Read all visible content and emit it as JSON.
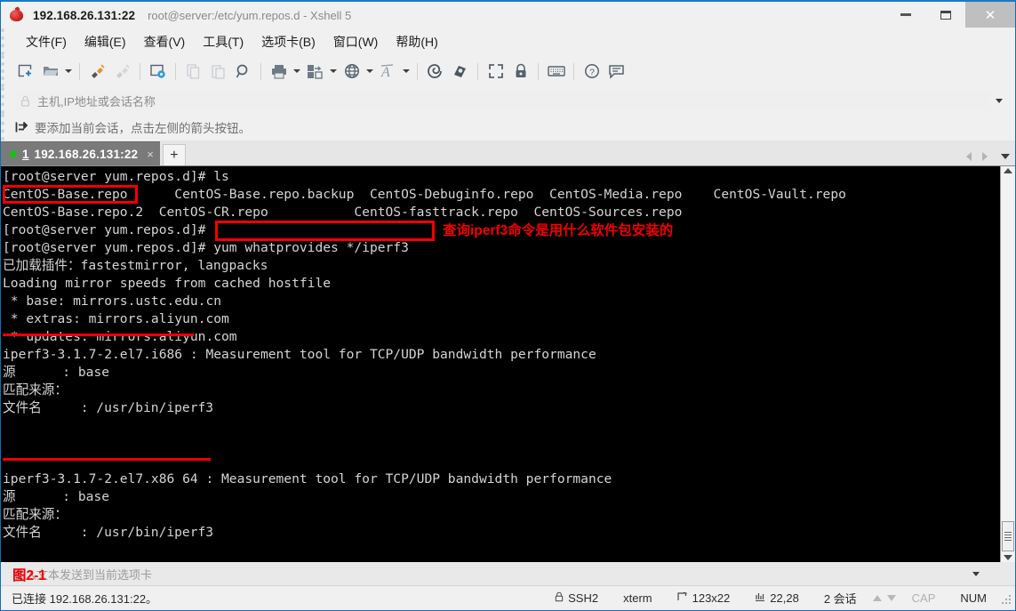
{
  "window": {
    "ip_title": "192.168.26.131:22",
    "path_title": "root@server:/etc/yum.repos.d - Xshell 5",
    "app_icon": "xshell-icon",
    "minimize": "−",
    "maximize": "□",
    "close": "✕"
  },
  "menu": {
    "items": [
      {
        "label": "文件(F)",
        "name": "menu-file"
      },
      {
        "label": "编辑(E)",
        "name": "menu-edit"
      },
      {
        "label": "查看(V)",
        "name": "menu-view"
      },
      {
        "label": "工具(T)",
        "name": "menu-tools"
      },
      {
        "label": "选项卡(B)",
        "name": "menu-tabs"
      },
      {
        "label": "窗口(W)",
        "name": "menu-window"
      },
      {
        "label": "帮助(H)",
        "name": "menu-help"
      }
    ]
  },
  "toolbar": {
    "icons": [
      "new-session-icon",
      "open-folder-icon",
      "connect-plug-icon",
      "disconnect-plug-icon",
      "session-properties-icon",
      "copy-icon",
      "paste-icon",
      "find-icon",
      "print-icon",
      "file-transfer-icon",
      "globe-icon",
      "font-icon",
      "shell-icon",
      "tunnel-icon",
      "fullscreen-icon",
      "lock-icon",
      "keyboard-icon",
      "help-icon",
      "chat-icon"
    ]
  },
  "quick_connect": {
    "lock_icon": "lock-icon",
    "placeholder": "主机,IP地址或会话名称",
    "dropdown_icon": "chevron-down-icon"
  },
  "hint": {
    "icon": "arrow-into-box-icon",
    "text": "要添加当前会话，点击左侧的箭头按钮。"
  },
  "tabs": {
    "active": {
      "status_dot_color": "#18c018",
      "number": "1",
      "label": "192.168.26.131:22",
      "close_label": "×"
    },
    "new_tab_label": "+",
    "nav_prev_icon": "chevron-left-icon",
    "nav_next_icon": "chevron-right-icon",
    "nav_list_icon": "chevron-down-icon"
  },
  "terminal": {
    "background": "#000000",
    "foreground": "#d4d4d4",
    "lines": [
      "[root@server yum.repos.d]# ls",
      "CentOS-Base.repo      CentOS-Base.repo.backup  CentOS-Debuginfo.repo  CentOS-Media.repo    CentOS-Vault.repo",
      "CentOS-Base.repo.2  CentOS-CR.repo           CentOS-fasttrack.repo  CentOS-Sources.repo",
      "[root@server yum.repos.d]#",
      "[root@server yum.repos.d]# yum whatprovides */iperf3",
      "已加载插件：fastestmirror, langpacks",
      "Loading mirror speeds from cached hostfile",
      " * base: mirrors.ustc.edu.cn",
      " * extras: mirrors.aliyun.com",
      " * updates: mirrors.aliyun.com",
      "iperf3-3.1.7-2.el7.i686 : Measurement tool for TCP/UDP bandwidth performance",
      "源      : base",
      "匹配来源：",
      "文件名     : /usr/bin/iperf3",
      "",
      "",
      "",
      "iperf3-3.1.7-2.el7.x86 64 : Measurement tool for TCP/UDP bandwidth performance",
      "源      : base",
      "匹配来源：",
      "文件名     : /usr/bin/iperf3",
      ""
    ]
  },
  "annotations": {
    "box_centos_base": "CentOS-Base.repo",
    "box_yum_command": "yum whatprovides */iperf3",
    "note_text": "查询iperf3命令是用什么软件包安装的",
    "underline_i686": "iperf3-3.1.7-2.el7.i686",
    "underline_x8664": "iperf3-3.1.7-2.el7.x86 64",
    "figure_label": "图2-1",
    "color": "#f20000"
  },
  "input_bar": {
    "placeholder": "输入文本发送到当前选项卡",
    "dropdown_icon": "chevron-down-icon"
  },
  "status_bar": {
    "connection": "已连接 192.168.26.131:22。",
    "protocol_icon": "lock-icon",
    "protocol": "SSH2",
    "terminal_type": "xterm",
    "size_icon": "resize-icon",
    "size": "123x22",
    "cursor_icon": "cursor-icon",
    "cursor": "22,28",
    "sessions": "2 会话",
    "transfer_up_icon": "arrow-up-icon",
    "transfer_down_icon": "arrow-down-icon",
    "caps": "CAP",
    "num": "NUM"
  }
}
